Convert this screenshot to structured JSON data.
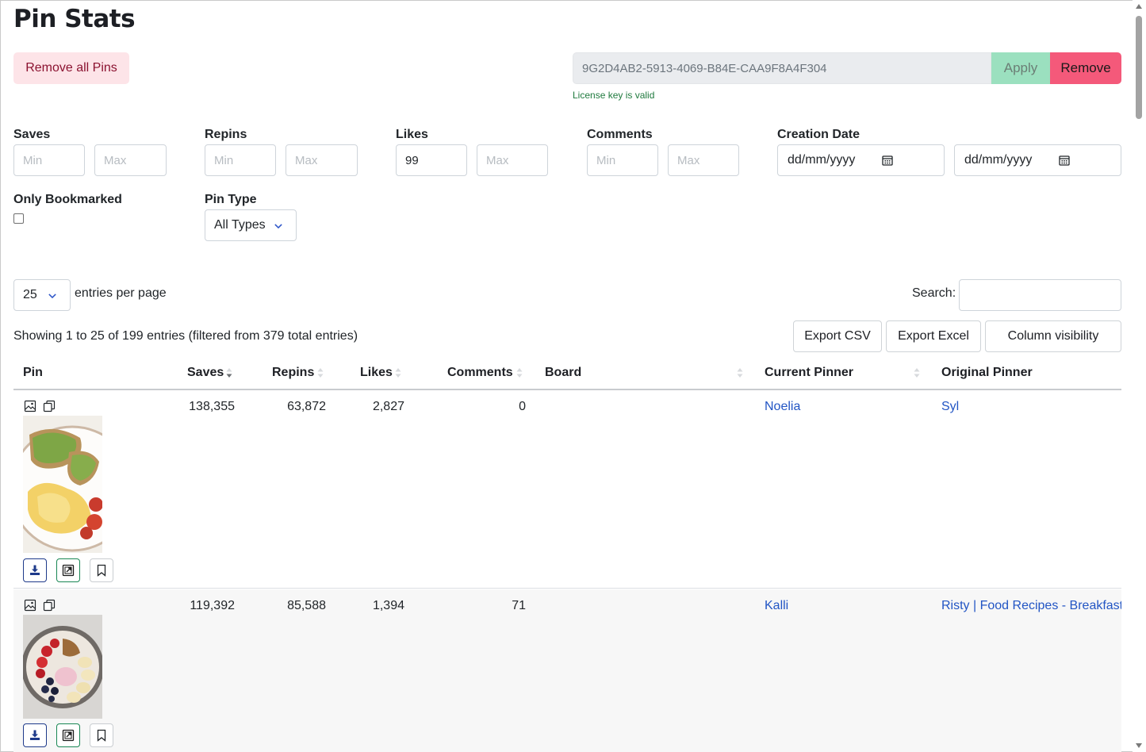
{
  "page": {
    "title": "Pin Stats"
  },
  "license": {
    "remove_all_label": "Remove all Pins",
    "key_value": "9G2D4AB2-5913-4069-B84E-CAA9F8A4F304",
    "apply_label": "Apply",
    "remove_label": "Remove",
    "status": "License key is valid"
  },
  "filters": {
    "saves": {
      "label": "Saves",
      "min_placeholder": "Min",
      "max_placeholder": "Max",
      "min_value": "",
      "max_value": ""
    },
    "repins": {
      "label": "Repins",
      "min_placeholder": "Min",
      "max_placeholder": "Max",
      "min_value": "",
      "max_value": ""
    },
    "likes": {
      "label": "Likes",
      "min_placeholder": "Min",
      "max_placeholder": "Max",
      "min_value": "99",
      "max_value": ""
    },
    "comments": {
      "label": "Comments",
      "min_placeholder": "Min",
      "max_placeholder": "Max",
      "min_value": "",
      "max_value": ""
    },
    "creation_date": {
      "label": "Creation Date",
      "from": "dd/mm/yyyy",
      "to": "dd/mm/yyyy"
    },
    "only_bookmarked": {
      "label": "Only Bookmarked",
      "checked": false
    },
    "pin_type": {
      "label": "Pin Type",
      "selected": "All Types"
    }
  },
  "table_controls": {
    "page_size": "25",
    "entries_label": "entries per page",
    "search_label": "Search:",
    "search_value": "",
    "info": "Showing 1 to 25 of 199 entries (filtered from 379 total entries)",
    "export_csv": "Export CSV",
    "export_excel": "Export Excel",
    "column_visibility": "Column visibility"
  },
  "table": {
    "columns": [
      "Pin",
      "Saves",
      "Repins",
      "Likes",
      "Comments",
      "Board",
      "Current Pinner",
      "Original Pinner"
    ],
    "rows": [
      {
        "saves": "138,355",
        "repins": "63,872",
        "likes": "2,827",
        "comments": "0",
        "board": "",
        "current_pinner": "Noelia",
        "original_pinner": "Syl"
      },
      {
        "saves": "119,392",
        "repins": "85,588",
        "likes": "1,394",
        "comments": "71",
        "board": "",
        "current_pinner": "Kalli",
        "original_pinner": "Risty | Food Recipes - Breakfast -"
      }
    ]
  },
  "colors": {
    "remove_all_bg": "#fde4e8",
    "apply_bg": "#9be0bf",
    "remove_bg": "#f4597a",
    "link": "#2255c4",
    "license_status": "#1f7a3e"
  },
  "icons": [
    "image-icon",
    "copy-icon",
    "download-icon",
    "open-external-icon",
    "bookmark-icon",
    "calendar-icon",
    "chevron-down-icon",
    "sort-icon"
  ]
}
